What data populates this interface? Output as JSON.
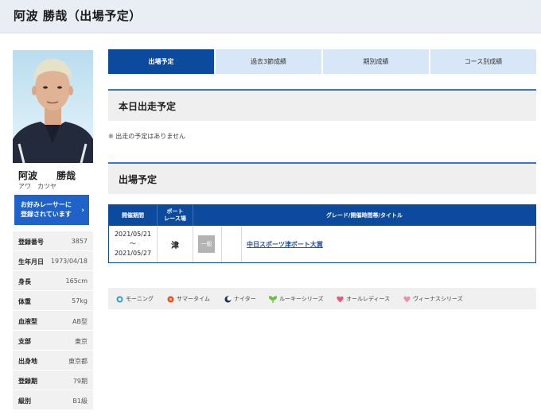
{
  "page": {
    "title": "阿波 勝哉（出場予定）"
  },
  "racer": {
    "name": "阿波　　勝哉",
    "kana": "アワ　カツヤ",
    "fav_button_line1": "お好みレーサーに",
    "fav_button_line2": "登録されています",
    "fav_button_chevron": "›",
    "profile": [
      {
        "key": "登録番号",
        "value": "3857"
      },
      {
        "key": "生年月日",
        "value": "1973/04/18"
      },
      {
        "key": "身長",
        "value": "165cm"
      },
      {
        "key": "体重",
        "value": "57kg"
      },
      {
        "key": "血液型",
        "value": "AB型"
      },
      {
        "key": "支部",
        "value": "東京"
      },
      {
        "key": "出身地",
        "value": "東京都"
      },
      {
        "key": "登録期",
        "value": "79期"
      },
      {
        "key": "級別",
        "value": "B1級"
      }
    ]
  },
  "tabs": [
    {
      "label": "出場予定",
      "active": true
    },
    {
      "label": "過去3節成績",
      "active": false
    },
    {
      "label": "期別成績",
      "active": false
    },
    {
      "label": "コース別成績",
      "active": false
    }
  ],
  "today": {
    "heading": "本日出走予定",
    "note": "※ 出走の予定はありません"
  },
  "schedule": {
    "heading": "出場予定",
    "columns": {
      "period": "開催期間",
      "venue_line1": "ボート",
      "venue_line2": "レース場",
      "grade_title": "グレード/開催時間帯/タイトル"
    },
    "rows": [
      {
        "start": "2021/05/21",
        "sep": "～",
        "end": "2021/05/27",
        "venue": "津",
        "grade": "一般",
        "title": "中日スポーツ津ボート大賞"
      }
    ]
  },
  "legend": [
    {
      "icon": "morning-icon",
      "label": "モーニング",
      "color": "#2aa1c9"
    },
    {
      "icon": "summer-time-icon",
      "label": "サマータイム",
      "color": "#e8502d"
    },
    {
      "icon": "nighter-icon",
      "label": "ナイター",
      "color": "#1b2f6b"
    },
    {
      "icon": "rookie-series-icon",
      "label": "ルーキーシリーズ",
      "color": "#6cbf3c"
    },
    {
      "icon": "all-ladies-icon",
      "label": "オールレディース",
      "color": "#e8557f"
    },
    {
      "icon": "venus-series-icon",
      "label": "ヴィーナスシリーズ",
      "color": "#f08db0"
    }
  ]
}
